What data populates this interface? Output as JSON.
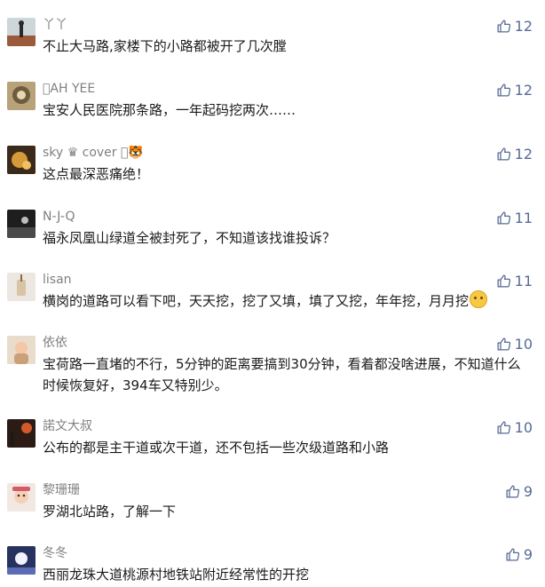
{
  "colors": {
    "accent": "#576b95",
    "name": "#808080",
    "text": "#1a1a1a"
  },
  "comments": [
    {
      "name": "丫丫",
      "text": "不止大马路,家楼下的小路都被开了几次膛",
      "likes": "12",
      "avatar_icon": "avatar-icon"
    },
    {
      "name": "\u0000AH YEE",
      "text": "宝安人民医院那条路，一年起码挖两次……",
      "likes": "12",
      "avatar_icon": "avatar-icon"
    },
    {
      "name": "sky ♛ cover \u0000🐯",
      "text": "这点最深恶痛绝！",
      "likes": "12",
      "avatar_icon": "avatar-icon"
    },
    {
      "name": "N-J-Q",
      "text": "福永凤凰山绿道全被封死了，不知道该找谁投诉？",
      "likes": "11",
      "avatar_icon": "avatar-icon"
    },
    {
      "name": "lisan",
      "text": "横岗的道路可以看下吧，天天挖，挖了又填，填了又挖，年年挖，月月挖",
      "likes": "11",
      "avatar_icon": "avatar-icon",
      "emoji": "awkward-face-emoji"
    },
    {
      "name": "依依",
      "text": "宝荷路一直堵的不行，5分钟的距离要搞到30分钟，看着都没啥进展，不知道什么时候恢复好，394车又特别少。",
      "likes": "10",
      "avatar_icon": "avatar-icon"
    },
    {
      "name": "諾文大叔",
      "text": "公布的都是主干道或次干道，还不包括一些次级道路和小路",
      "likes": "10",
      "avatar_icon": "avatar-icon"
    },
    {
      "name": "黎珊珊",
      "text": "罗湖北站路，了解一下",
      "likes": "9",
      "avatar_icon": "avatar-icon"
    },
    {
      "name": "冬冬",
      "text": "西丽龙珠大道桃源村地铁站附近经常性的开挖",
      "likes": "9",
      "avatar_icon": "avatar-icon"
    }
  ]
}
